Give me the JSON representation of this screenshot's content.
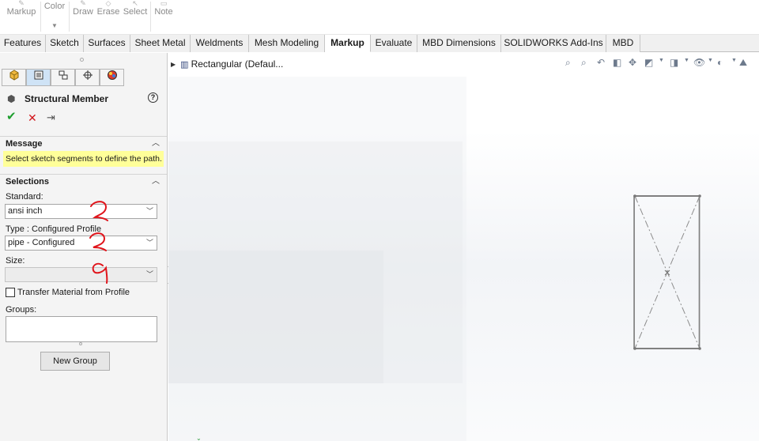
{
  "ribbon": {
    "tools": [
      "Markup",
      "Color",
      "Draw",
      "Erase",
      "Select",
      "Note"
    ]
  },
  "tabs": [
    "Features",
    "Sketch",
    "Surfaces",
    "Sheet Metal",
    "Weldments",
    "Mesh Modeling",
    "Markup",
    "Evaluate",
    "MBD Dimensions",
    "SOLIDWORKS Add-Ins",
    "MBD"
  ],
  "active_tab": "Markup",
  "property_manager": {
    "title": "Structural Member",
    "help": "?",
    "ok": "✔",
    "cancel": "✕",
    "pin": "⇥",
    "message": {
      "header": "Message",
      "text": "Select sketch segments to define the path."
    },
    "selections": {
      "header": "Selections",
      "standard_label": "Standard:",
      "standard_value": "ansi inch",
      "type_label": "Type : Configured Profile",
      "type_value": "pipe - Configured",
      "size_label": "Size:",
      "size_value": "",
      "transfer_label": "Transfer Material from Profile",
      "transfer_checked": false,
      "groups_label": "Groups:",
      "new_group_label": "New Group"
    }
  },
  "feature_tree": {
    "item": "Rectangular  (Defaul..."
  },
  "annotation_color": "#e0141b",
  "accent_color": "#cfe3f6"
}
